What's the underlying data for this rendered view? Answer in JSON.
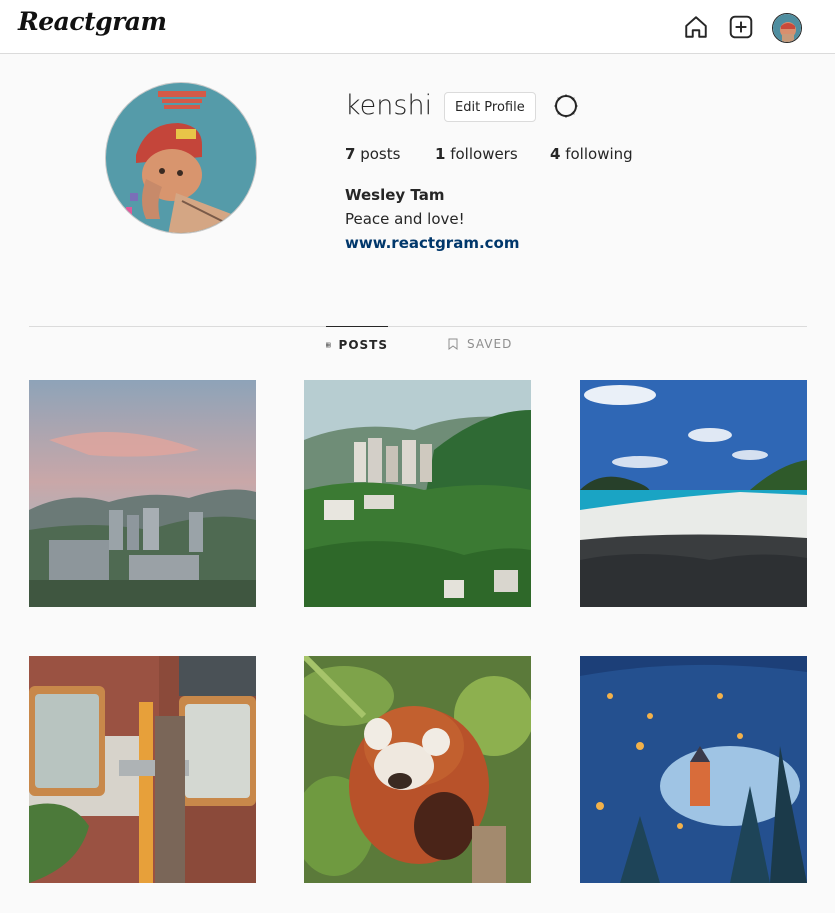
{
  "app": {
    "logo_text": "Reactgram"
  },
  "nav": {
    "icons": [
      "home-icon",
      "add-post-icon",
      "avatar"
    ]
  },
  "profile": {
    "username": "kenshi",
    "edit_label": "Edit Profile",
    "settings_icon": "settings-icon",
    "stats": {
      "posts_count": "7",
      "posts_label": "posts",
      "followers_count": "1",
      "followers_label": "followers",
      "following_count": "4",
      "following_label": "following"
    },
    "full_name": "Wesley Tam",
    "bio": "Peace and love!",
    "website": "www.reactgram.com"
  },
  "tabs": [
    {
      "label": "POSTS",
      "icon": "grid-icon",
      "active": true
    },
    {
      "label": "SAVED",
      "icon": "bookmark-icon",
      "active": false
    }
  ],
  "posts": [
    {
      "subject": "city-sunset-photo"
    },
    {
      "subject": "green-hills-photo"
    },
    {
      "subject": "beach-photo"
    },
    {
      "subject": "street-mirrors-photo"
    },
    {
      "subject": "red-panda-photo"
    },
    {
      "subject": "snowy-village-photo"
    }
  ],
  "colors": {
    "link": "#00376b",
    "border": "#dbdbdb",
    "text": "#262626",
    "muted": "#8e8e8e"
  }
}
